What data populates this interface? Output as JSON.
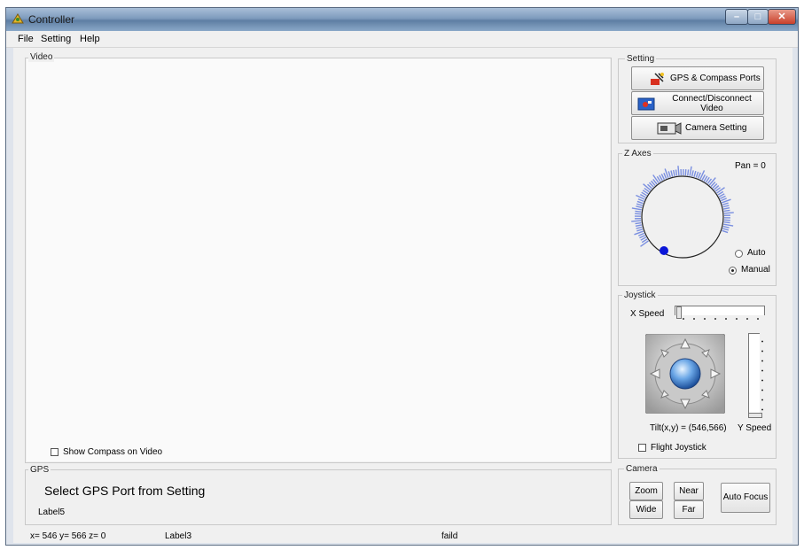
{
  "window": {
    "title": "Controller"
  },
  "menu": [
    "File",
    "Setting",
    "Help"
  ],
  "video": {
    "group_label": "Video",
    "show_compass_label": "Show Compass on Video",
    "show_compass_checked": false
  },
  "gps": {
    "group_label": "GPS",
    "message": "Select GPS Port from Setting",
    "label5": "Label5"
  },
  "setting": {
    "group_label": "Setting",
    "gps_button": "GPS & Compass Ports",
    "video_button": "Connect/Disconnect Video",
    "camera_button": "Camera Setting"
  },
  "z_axes": {
    "group_label": "Z Axes",
    "pan_text": "Pan = 0",
    "auto_label": "Auto",
    "manual_label": "Manual",
    "selected_mode": "Manual"
  },
  "joystick": {
    "group_label": "Joystick",
    "x_speed_label": "X Speed",
    "y_speed_label": "Y Speed",
    "tilt_text": "Tilt(x,y) = (546,566)",
    "flight_joystick_label": "Flight Joystick",
    "flight_joystick_checked": false
  },
  "camera": {
    "group_label": "Camera",
    "zoom": "Zoom",
    "wide": "Wide",
    "near": "Near",
    "far": "Far",
    "auto_focus": "Auto Focus"
  },
  "status": {
    "coords": "x= 546  y= 566  z= 0",
    "label3": "Label3",
    "failed": "faild"
  },
  "colors": {
    "dial_tick": "#7a8fe0",
    "dial_dot": "#0b16d8",
    "title_bar": "#7e9bbd",
    "close_button": "#c9402a"
  }
}
